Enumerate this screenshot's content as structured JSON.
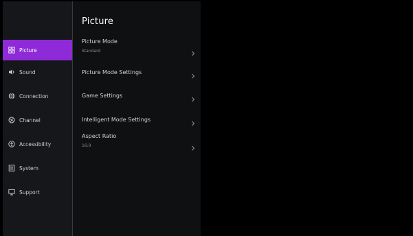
{
  "panel": {
    "title": "Picture"
  },
  "sidebar": {
    "items": [
      {
        "label": "Picture",
        "icon": "picture-icon",
        "active": true
      },
      {
        "label": "Sound",
        "icon": "sound-icon",
        "active": false
      },
      {
        "label": "Connection",
        "icon": "connection-icon",
        "active": false
      },
      {
        "label": "Channel",
        "icon": "channel-icon",
        "active": false
      },
      {
        "label": "Accessibility",
        "icon": "accessibility-icon",
        "active": false
      },
      {
        "label": "System",
        "icon": "system-icon",
        "active": false
      },
      {
        "label": "Support",
        "icon": "support-icon",
        "active": false
      }
    ]
  },
  "menu": {
    "items": [
      {
        "label": "Picture Mode",
        "value": "Standard"
      },
      {
        "label": "Picture Mode Settings"
      },
      {
        "label": "Game Settings"
      },
      {
        "label": "Intelligent Mode Settings"
      },
      {
        "label": "Aspect Ratio",
        "value": "16:9"
      }
    ]
  },
  "colors": {
    "accent": "#8e2ad8",
    "sidebar_bg": "#16171a",
    "panel_bg": "#0f1012",
    "screen_bg": "#000000"
  }
}
